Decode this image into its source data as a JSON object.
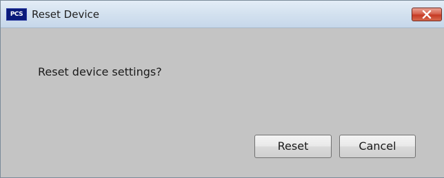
{
  "window": {
    "title": "Reset Device",
    "app_icon_text": "PCS",
    "close_icon": "close-x-icon"
  },
  "dialog": {
    "message": "Reset device settings?",
    "buttons": {
      "reset_label": "Reset",
      "cancel_label": "Cancel"
    }
  },
  "colors": {
    "body_background": "#c4c4c4",
    "titlebar": "#d3e1ef",
    "close_button": "#c63a24",
    "app_icon": "#0a1a7a"
  }
}
